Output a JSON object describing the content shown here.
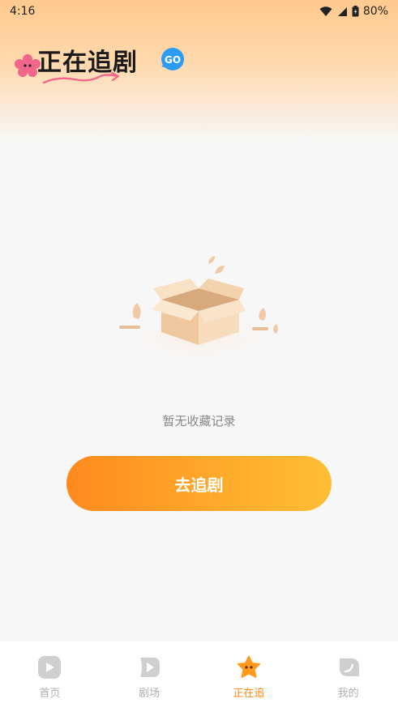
{
  "status_bar": {
    "time": "4:16",
    "battery": "80%",
    "icons": [
      "wifi-icon",
      "signal-icon",
      "battery-icon"
    ]
  },
  "header": {
    "title": "正在追剧",
    "badge": "GO",
    "colors": {
      "gradient_top": "#ffc98f",
      "badge": "#2b9bf4",
      "deco_pink": "#f2668b"
    }
  },
  "empty_state": {
    "illustration": "empty-box-icon",
    "message": "暂无收藏记录",
    "button_label": "去追剧"
  },
  "tabbar": {
    "items": [
      {
        "label": "首页",
        "icon": "play-square-icon",
        "active": false
      },
      {
        "label": "剧场",
        "icon": "play-ticket-icon",
        "active": false
      },
      {
        "label": "正在追",
        "icon": "star-icon",
        "active": true
      },
      {
        "label": "我的",
        "icon": "profile-leaf-icon",
        "active": false
      }
    ],
    "active_color": "#ff8a1e",
    "inactive_color": "#b0b0b0"
  }
}
